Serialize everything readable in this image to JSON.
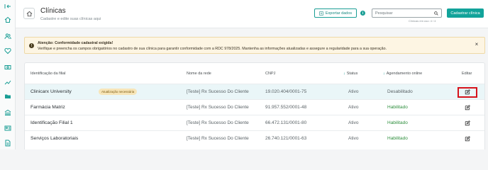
{
  "sidebar": {
    "items": [
      {
        "icon": "collapse-icon"
      },
      {
        "icon": "home-icon"
      },
      {
        "icon": "users-icon"
      },
      {
        "icon": "heart-icon"
      },
      {
        "icon": "money-icon"
      },
      {
        "icon": "chart-icon"
      },
      {
        "icon": "folder-icon"
      },
      {
        "icon": "building-icon"
      },
      {
        "icon": "id-card-icon"
      },
      {
        "icon": "document-icon"
      }
    ]
  },
  "header": {
    "title": "Clínicas",
    "subtitle": "Cadastre e edite suas clínicas aqui",
    "export_label": "Exportar dados",
    "search_placeholder": "Pesquisar",
    "search_count": "Clínicas em uso: 4 / 4",
    "primary_label": "Cadastrar clínica",
    "accent_color": "#12a39a"
  },
  "alert": {
    "title": "Atenção: Conformidade cadastral exigida!",
    "text": "Verifique e preencha os campos obrigatórios no cadastro de sua clínica para garantir conformidade com a RDC 978/2025. Mantenha as informações atualizadas e assegure a regularidade para a sua operação."
  },
  "table": {
    "columns": {
      "id": "Identificação da filial",
      "network": "Nome da rede",
      "cnpj": "CNPJ",
      "status": "Status",
      "schedule": "Agendamento online",
      "edit": "Editar"
    },
    "rows": [
      {
        "name": "Clinicarx University",
        "badge": "Atualização necessária",
        "network": "[Teste] Rx Sucesso Do Cliente",
        "cnpj": "19.020.404/0001-75",
        "status": "Ativo",
        "schedule": "Desabilitado",
        "selected": true
      },
      {
        "name": "Farmácia Matriz",
        "badge": "",
        "network": "[Teste] Rx Sucesso Do Cliente",
        "cnpj": "91.957.552/0001-48",
        "status": "Ativo",
        "schedule": "Habilitado",
        "selected": false
      },
      {
        "name": "Identificação Filial 1",
        "badge": "",
        "network": "[Teste] Rx Sucesso Do Cliente",
        "cnpj": "66.472.131/0001-80",
        "status": "Ativo",
        "schedule": "Habilitado",
        "selected": false
      },
      {
        "name": "Serviços Laboratoriais",
        "badge": "",
        "network": "[Teste] Rx Sucesso Do Cliente",
        "cnpj": "26.740.121/0001-63",
        "status": "Ativo",
        "schedule": "Habilitado",
        "selected": false
      }
    ]
  }
}
